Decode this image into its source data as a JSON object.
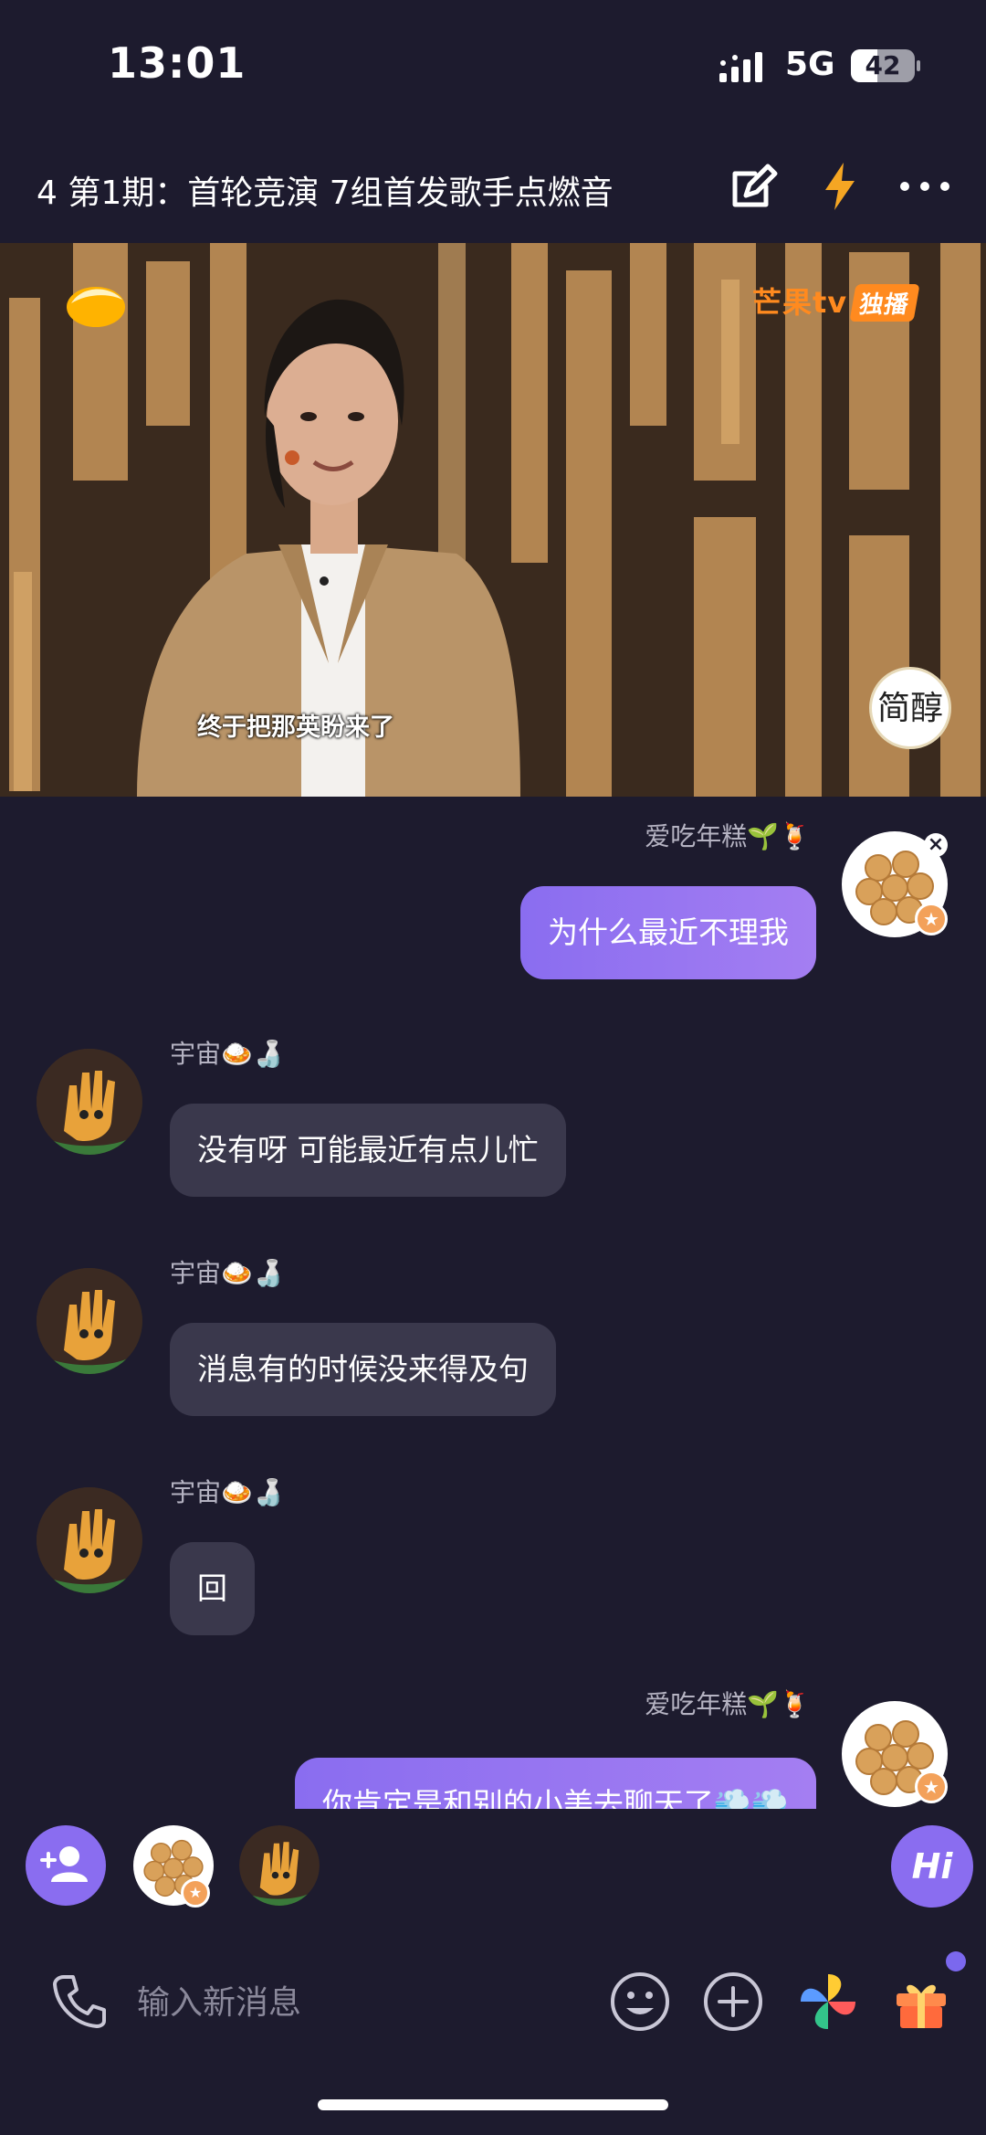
{
  "status_bar": {
    "time": "13:01",
    "network": "5G",
    "battery": "42",
    "battery_level": 0.42
  },
  "header": {
    "title": "4 第1期：首轮竞演 7组首发歌手点燃音",
    "icons": [
      "edit-icon",
      "lightning-icon",
      "more-icon"
    ]
  },
  "video": {
    "subtitle": "终于把那英盼来了",
    "channel_logo": "芒果tv",
    "exclusive_tag": "独播",
    "brand_badge": "简醇"
  },
  "messages": [
    {
      "sender": "爱吃年糕🌱🍹",
      "text": "为什么最近不理我",
      "direction": "out"
    },
    {
      "sender": "宇宙🍛🍶",
      "text": "没有呀 可能最近有点儿忙",
      "direction": "in"
    },
    {
      "sender": "宇宙🍛🍶",
      "text": "消息有的时候没来得及句",
      "direction": "in"
    },
    {
      "sender": "宇宙🍛🍶",
      "text": "回",
      "direction": "in"
    },
    {
      "sender": "爱吃年糕🌱🍹",
      "text": "你肯定是和别的小美去聊天了💨💨",
      "direction": "out"
    }
  ],
  "member_bar": {
    "hi_label": "Hi"
  },
  "input": {
    "placeholder": "输入新消息",
    "value": ""
  },
  "colors": {
    "background": "#1d1b2e",
    "accent": "#8a6df0",
    "incoming_bubble": "#3a384c"
  }
}
